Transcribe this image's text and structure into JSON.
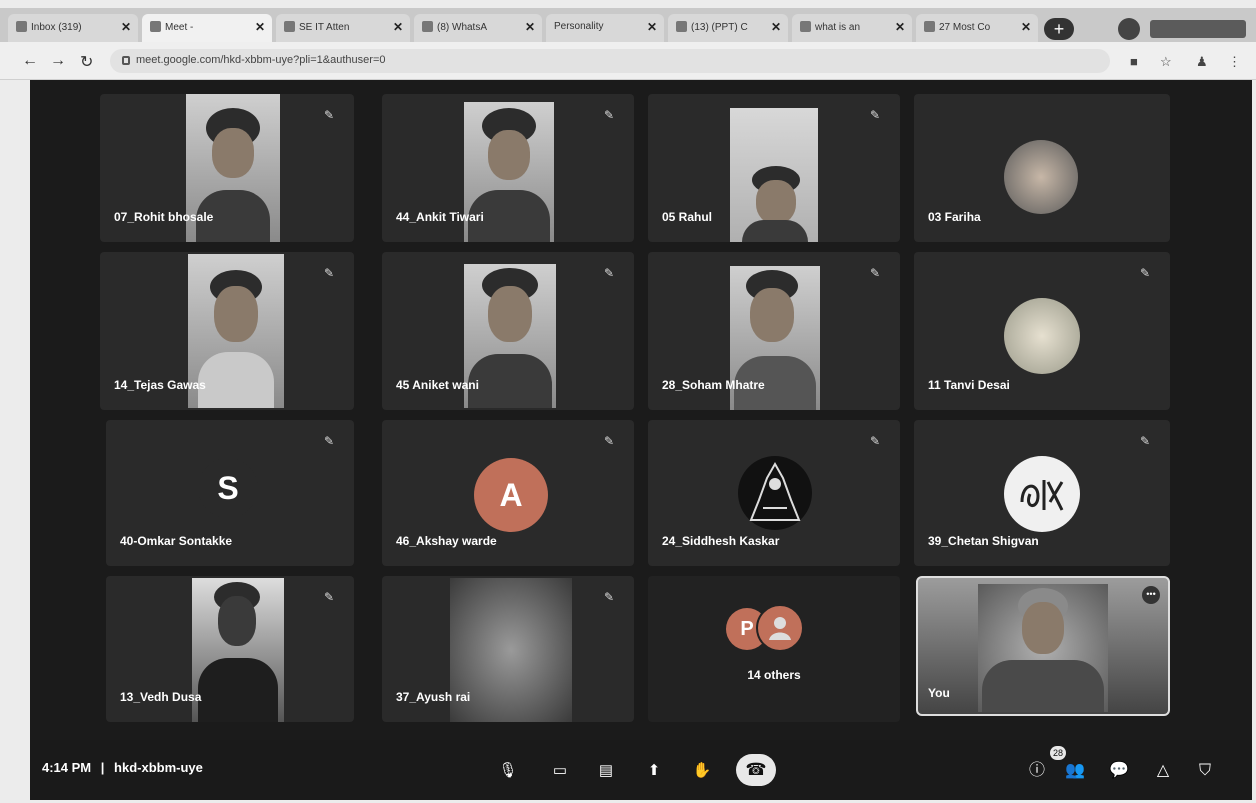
{
  "browser": {
    "tabs": [
      {
        "label": "Inbox (319)"
      },
      {
        "label": "Meet -"
      },
      {
        "label": "SE IT Atten"
      },
      {
        "label": "(8) WhatsA"
      },
      {
        "label": "Personality"
      },
      {
        "label": "(13) (PPT) C"
      },
      {
        "label": "what is an"
      },
      {
        "label": "27 Most Co"
      }
    ],
    "url": "meet.google.com/hkd-xbbm-uye?pli=1&authuser=0"
  },
  "meet": {
    "participants": [
      {
        "name": "07_Rohit bhosale"
      },
      {
        "name": "44_Ankit Tiwari"
      },
      {
        "name": "05 Rahul"
      },
      {
        "name": "03 Fariha"
      },
      {
        "name": "14_Tejas Gawas"
      },
      {
        "name": "45 Aniket wani"
      },
      {
        "name": "28_Soham Mhatre"
      },
      {
        "name": "11 Tanvi Desai"
      },
      {
        "name": "40-Omkar Sontakke",
        "initial": "S"
      },
      {
        "name": "46_Akshay warde",
        "initial": "A"
      },
      {
        "name": "24_Siddhesh Kaskar"
      },
      {
        "name": "39_Chetan Shigvan"
      },
      {
        "name": "13_Vedh Dusa"
      },
      {
        "name": "37_Ayush rai"
      }
    ],
    "others": {
      "initial": "P",
      "label": "14 others"
    },
    "self": {
      "label": "You"
    },
    "bottom": {
      "time": "4:14 PM",
      "separator": "|",
      "meeting_code": "hkd-xbbm-uye",
      "people_count": "28"
    }
  }
}
